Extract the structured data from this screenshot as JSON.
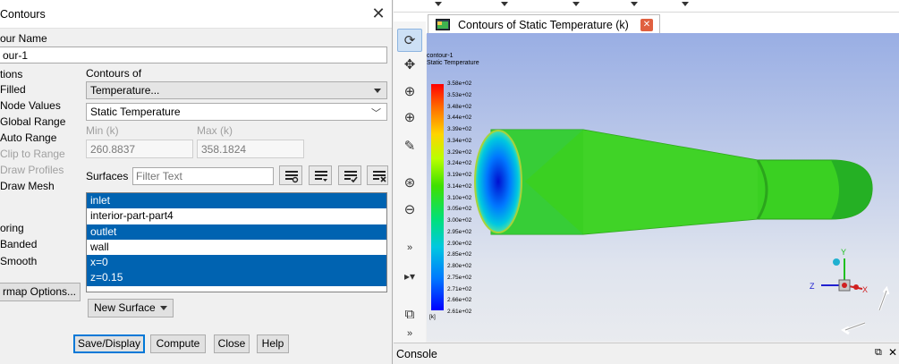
{
  "dialog": {
    "title": "Contours",
    "name_label": "our Name",
    "name_value": "our-1",
    "options_label": "tions",
    "options": [
      {
        "label": "Filled",
        "disabled": false
      },
      {
        "label": "Node Values",
        "disabled": false
      },
      {
        "label": "Global Range",
        "disabled": false
      },
      {
        "label": "Auto Range",
        "disabled": false
      },
      {
        "label": "Clip to Range",
        "disabled": true
      },
      {
        "label": "Draw Profiles",
        "disabled": true
      },
      {
        "label": "Draw Mesh",
        "disabled": false
      }
    ],
    "coloring_label": "oring",
    "coloring": [
      "Banded",
      "Smooth"
    ],
    "colormap_button": "rmap Options...",
    "contours_of_label": "Contours of",
    "contours_of_value": "Temperature...",
    "contours_of_sub": "Static Temperature",
    "min_label": "Min (k)",
    "max_label": "Max (k)",
    "min_value": "260.8837",
    "max_value": "358.1824",
    "surfaces_label": "Surfaces",
    "filter_placeholder": "Filter Text",
    "surfaces": [
      {
        "label": "inlet",
        "selected": true
      },
      {
        "label": "interior-part-part4",
        "selected": false
      },
      {
        "label": "outlet",
        "selected": true
      },
      {
        "label": "wall",
        "selected": false
      },
      {
        "label": "x=0",
        "selected": true
      },
      {
        "label": "z=0.15",
        "selected": true
      }
    ],
    "new_surface": "New Surface",
    "buttons": {
      "save": "Save/Display",
      "compute": "Compute",
      "close": "Close",
      "help": "Help"
    }
  },
  "graphics": {
    "tab_title": "Contours of Static Temperature (k)",
    "plot_title_line1": "contour-1",
    "plot_title_line2": "Static Temperature",
    "colorbar_ticks": [
      "3.58e+02",
      "3.53e+02",
      "3.48e+02",
      "3.44e+02",
      "3.39e+02",
      "3.34e+02",
      "3.29e+02",
      "3.24e+02",
      "3.19e+02",
      "3.14e+02",
      "3.10e+02",
      "3.05e+02",
      "3.00e+02",
      "2.95e+02",
      "2.90e+02",
      "2.85e+02",
      "2.80e+02",
      "2.75e+02",
      "2.71e+02",
      "2.66e+02",
      "2.61e+02"
    ],
    "colorbar_unit": "[k]",
    "axes": {
      "x": "X",
      "y": "Y",
      "z": "Z"
    },
    "console_label": "Console",
    "colors": {
      "selection": "#0063b1",
      "accent": "#0078d7"
    }
  }
}
